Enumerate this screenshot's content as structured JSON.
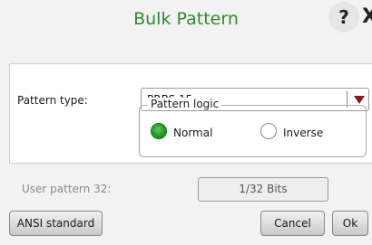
{
  "dialog": {
    "title": "Bulk Pattern",
    "help_glyph": "?",
    "close_glyph": "X"
  },
  "pattern": {
    "type_label": "Pattern type:",
    "type_value": "PRBS 15",
    "logic_legend": "Pattern logic",
    "options": [
      {
        "label": "Normal",
        "selected": true
      },
      {
        "label": "Inverse",
        "selected": false
      }
    ]
  },
  "user_pattern": {
    "label": "User pattern 32:",
    "value": "1/32 Bits"
  },
  "buttons": {
    "ansi": "ANSI standard",
    "cancel": "Cancel",
    "ok": "Ok"
  },
  "colors": {
    "title": "#2e8b2e",
    "radio_selected": "#1f9a1f",
    "dropdown_arrow": "#8b1a1a"
  },
  "icons": {
    "help": "help-icon",
    "close": "close-icon",
    "dropdown": "dropdown-arrow-icon"
  }
}
